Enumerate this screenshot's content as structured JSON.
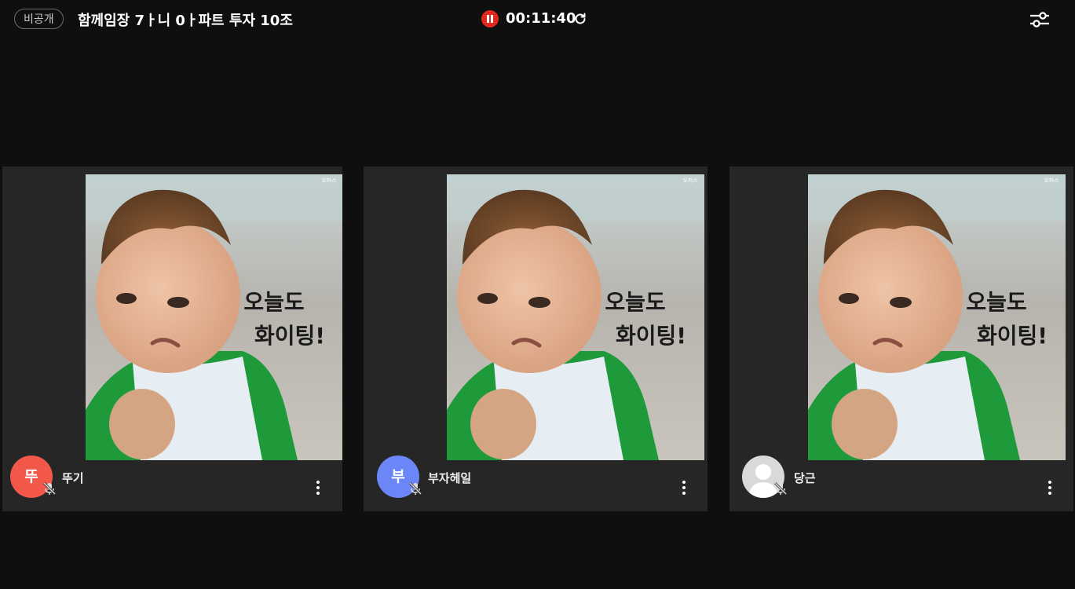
{
  "header": {
    "visibility_badge": "비공개",
    "room_title": "함께임장 7ㅏ니 0ㅏ파트 투자 10조",
    "record_status_icon": "pause-icon",
    "timer": "00:11:40",
    "refresh_icon": "refresh-icon",
    "settings_icon": "settings-sliders-icon"
  },
  "image_text": {
    "line1": "오늘도",
    "line2": "화이팅!",
    "watermark": "오피스"
  },
  "participants": [
    {
      "avatar_text": "뚜",
      "avatar_color": "#f1584a",
      "name": "뚜기",
      "mic": "muted"
    },
    {
      "avatar_text": "부",
      "avatar_color": "#6a86f7",
      "name": "부자헤일",
      "mic": "muted"
    },
    {
      "avatar_text": "",
      "avatar_color": "#d9d9d9",
      "name": "당근",
      "mic": "muted",
      "avatar_icon": "default-user-icon"
    }
  ],
  "colors": {
    "background": "#0f0f0f",
    "tile": "#262626",
    "record": "#e2281c"
  }
}
